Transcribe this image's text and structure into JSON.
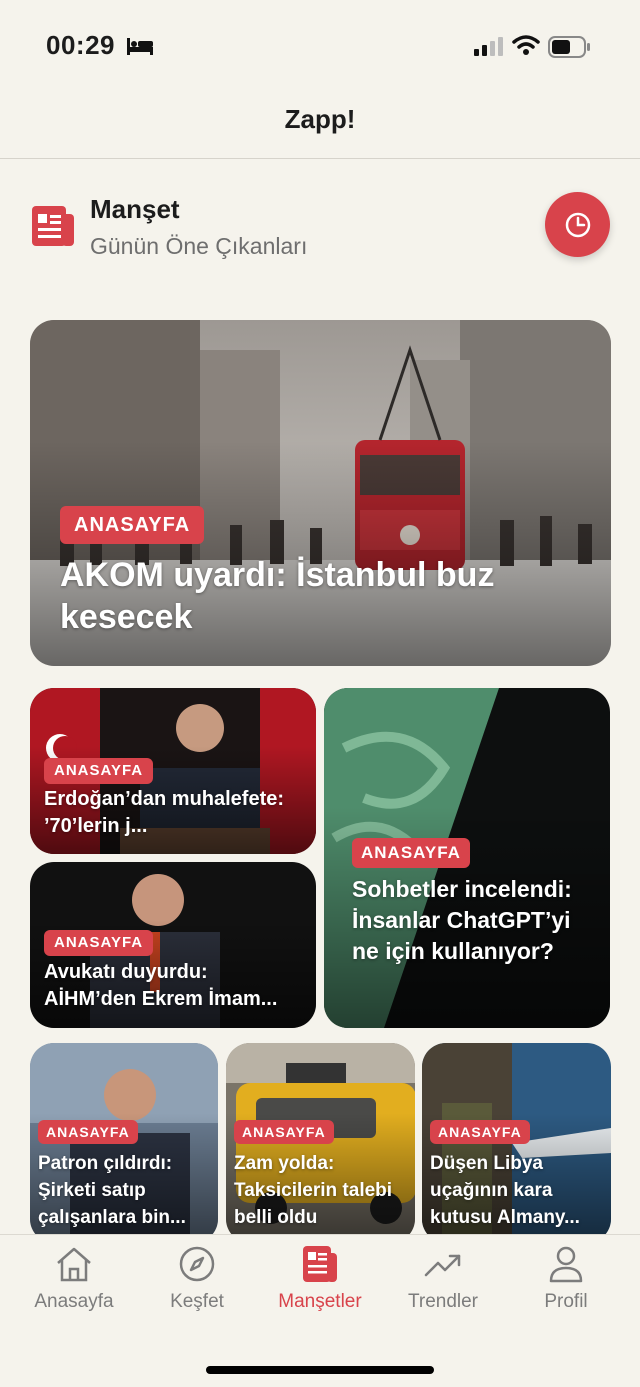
{
  "status_bar": {
    "time": "00:29"
  },
  "nav": {
    "title": "Zapp!"
  },
  "section": {
    "title": "Manşet",
    "subtitle": "Günün Öne Çıkanları"
  },
  "articles": [
    {
      "category": "ANASAYFA",
      "title": "AKOM uyardı: İstanbul buz kesecek"
    },
    {
      "category": "ANASAYFA",
      "title": "Erdoğan’dan muhalefete: ’70’lerin j..."
    },
    {
      "category": "ANASAYFA",
      "title": "Sohbetler incelendi: İnsanlar ChatGPT’yi ne için kullanıyor?"
    },
    {
      "category": "ANASAYFA",
      "title": "Avukatı duyurdu: AİHM’den Ekrem İmam..."
    },
    {
      "category": "ANASAYFA",
      "title": "Patron çıldırdı: Şirketi satıp çalışanlara bin..."
    },
    {
      "category": "ANASAYFA",
      "title": "Zam yolda: Taksicilerin talebi belli oldu"
    },
    {
      "category": "ANASAYFA",
      "title": "Düşen Libya uçağının kara kutusu Almany..."
    }
  ],
  "tab_bar": {
    "items": [
      {
        "label": "Anasayfa",
        "icon": "home-icon"
      },
      {
        "label": "Keşfet",
        "icon": "compass-icon"
      },
      {
        "label": "Manşetler",
        "icon": "newspaper-icon",
        "active": true
      },
      {
        "label": "Trendler",
        "icon": "trending-icon"
      },
      {
        "label": "Profil",
        "icon": "person-icon"
      }
    ]
  },
  "colors": {
    "accent": "#d8434b",
    "background": "#f5f3ec"
  }
}
